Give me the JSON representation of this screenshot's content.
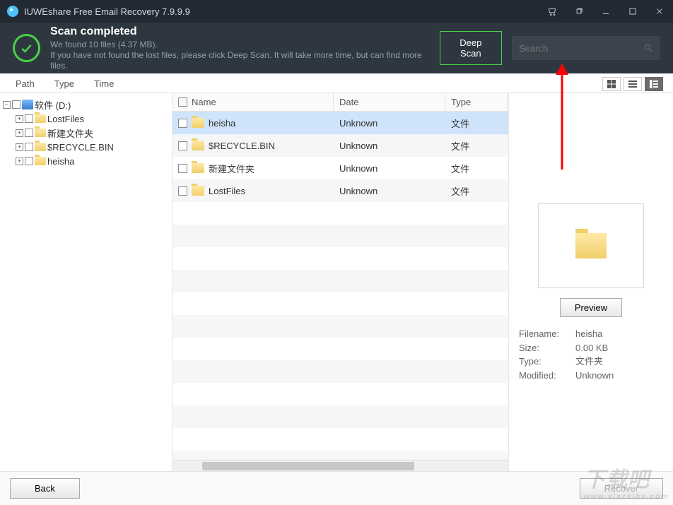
{
  "window": {
    "title": "IUWEshare Free Email Recovery 7.9.9.9"
  },
  "header": {
    "title": "Scan completed",
    "subtitle1": "We found 10 files (4.37 MB).",
    "subtitle2": "If you have not found the lost files, please click Deep Scan. It will take more time, but can find more files.",
    "deep_scan_label": "Deep Scan",
    "search_placeholder": "Search"
  },
  "tabs": {
    "path": "Path",
    "type": "Type",
    "time": "Time"
  },
  "tree": {
    "root": "软件 (D:)",
    "children": [
      "LostFiles",
      "新建文件夹",
      "$RECYCLE.BIN",
      "heisha"
    ]
  },
  "table": {
    "headers": {
      "name": "Name",
      "date": "Date",
      "type": "Type"
    },
    "rows": [
      {
        "name": "heisha",
        "date": "Unknown",
        "type": "文件",
        "selected": true
      },
      {
        "name": "$RECYCLE.BIN",
        "date": "Unknown",
        "type": "文件",
        "selected": false
      },
      {
        "name": "新建文件夹",
        "date": "Unknown",
        "type": "文件",
        "selected": false
      },
      {
        "name": "LostFiles",
        "date": "Unknown",
        "type": "文件",
        "selected": false
      }
    ]
  },
  "preview": {
    "button": "Preview",
    "labels": {
      "filename": "Filename:",
      "size": "Size:",
      "type": "Type:",
      "modified": "Modified:"
    },
    "values": {
      "filename": "heisha",
      "size": "0.00 KB",
      "type": "文件夹",
      "modified": "Unknown"
    }
  },
  "footer": {
    "back": "Back",
    "recover": "Recover"
  },
  "watermark": {
    "big": "下载吧",
    "small": "www.xiazaiba.com"
  }
}
